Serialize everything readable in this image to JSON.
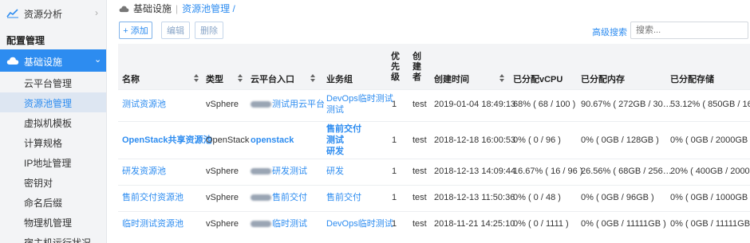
{
  "sidebar": {
    "top_item": {
      "label": "资源分析"
    },
    "section_title": "配置管理",
    "active_group": {
      "label": "基础设施"
    },
    "items": [
      {
        "label": "云平台管理"
      },
      {
        "label": "资源池管理"
      },
      {
        "label": "虚拟机模板"
      },
      {
        "label": "计算规格"
      },
      {
        "label": "IP地址管理"
      },
      {
        "label": "密钥对"
      },
      {
        "label": "命名后缀"
      },
      {
        "label": "物理机管理"
      },
      {
        "label": "宿主机运行状况"
      }
    ],
    "current_index": 1
  },
  "breadcrumb": {
    "root": "基础设施",
    "current": "资源池管理 /"
  },
  "toolbar": {
    "add_label": "+ 添加",
    "edit_label": "编辑",
    "delete_label": "删除",
    "advanced_search": "高级搜索",
    "search_placeholder": "搜索..."
  },
  "table": {
    "headers": [
      "名称",
      "类型",
      "云平台入口",
      "业务组",
      "优先级",
      "创建者",
      "创建时间",
      "已分配vCPU",
      "已分配内存",
      "已分配存储"
    ],
    "rows": [
      {
        "name": "测试资源池",
        "type": "vSphere",
        "entry": "测试用云平台",
        "groups": [
          "DevOps临时测试",
          "测试"
        ],
        "priority": "1",
        "creator": "test",
        "created": "2019-01-04 18:49:13",
        "vcpu": "68% ( 68 / 100 )",
        "memory": "90.67% ( 272GB / 30…",
        "storage": "53.12% ( 850GB / 16…"
      },
      {
        "name": "OpenStack共享资源池",
        "type": "OpenStack",
        "entry": "openstack",
        "groups": [
          "售前交付",
          "测试",
          "研发"
        ],
        "priority": "1",
        "creator": "test",
        "created": "2018-12-18 16:00:53",
        "vcpu": "0% ( 0 / 96 )",
        "memory": "0% ( 0GB / 128GB )",
        "storage": "0% ( 0GB / 2000GB )"
      },
      {
        "name": "研发资源池",
        "type": "vSphere",
        "entry": "研发测试",
        "groups": [
          "研发"
        ],
        "priority": "1",
        "creator": "test",
        "created": "2018-12-13 14:09:44",
        "vcpu": "16.67% ( 16 / 96 )",
        "memory": "26.56% ( 68GB / 256…",
        "storage": "20% ( 400GB / 2000…"
      },
      {
        "name": "售前交付资源池",
        "type": "vSphere",
        "entry": "售前交付",
        "groups": [
          "售前交付"
        ],
        "priority": "1",
        "creator": "test",
        "created": "2018-12-13 11:50:36",
        "vcpu": "0% ( 0 / 48 )",
        "memory": "0% ( 0GB / 96GB )",
        "storage": "0% ( 0GB / 1000GB )"
      },
      {
        "name": "临时测试资源池",
        "type": "vSphere",
        "entry": "临时测试",
        "groups": [
          "DevOps临时测试"
        ],
        "priority": "1",
        "creator": "test",
        "created": "2018-11-21 14:25:10",
        "vcpu": "0% ( 0 / 1111 )",
        "memory": "0% ( 0GB / 11111GB )",
        "storage": "0% ( 0GB / 11111GB )"
      }
    ]
  },
  "colors": {
    "accent": "#2d8cf0",
    "sidebar_bg": "#f3f4f6",
    "header_bg": "#f3f4f6"
  }
}
